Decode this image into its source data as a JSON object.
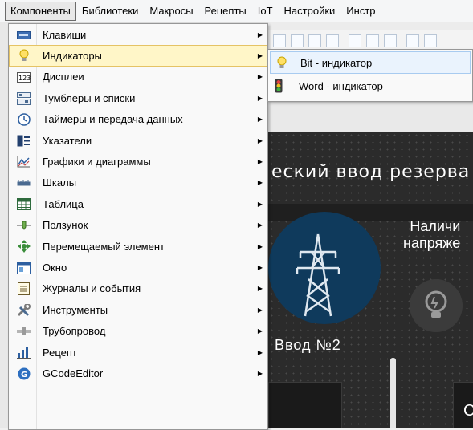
{
  "menubar": {
    "items": [
      "Компоненты",
      "Библиотеки",
      "Макросы",
      "Рецепты",
      "IoT",
      "Настройки",
      "Инстр"
    ]
  },
  "dropdown": {
    "items": [
      {
        "label": "Клавиши",
        "icon": "keyboard-icon"
      },
      {
        "label": "Индикаторы",
        "icon": "bulb-icon"
      },
      {
        "label": "Дисплеи",
        "icon": "display-123-icon"
      },
      {
        "label": "Тумблеры и списки",
        "icon": "toggle-list-icon"
      },
      {
        "label": "Таймеры и передача данных",
        "icon": "clock-icon"
      },
      {
        "label": "Указатели",
        "icon": "pointer-icon"
      },
      {
        "label": "Графики и диаграммы",
        "icon": "chart-icon"
      },
      {
        "label": "Шкалы",
        "icon": "scale-icon"
      },
      {
        "label": "Таблица",
        "icon": "table-icon"
      },
      {
        "label": "Ползунок",
        "icon": "slider-icon"
      },
      {
        "label": "Перемещаемый элемент",
        "icon": "move-icon"
      },
      {
        "label": "Окно",
        "icon": "window-icon"
      },
      {
        "label": "Журналы и события",
        "icon": "log-icon"
      },
      {
        "label": "Инструменты",
        "icon": "tools-icon"
      },
      {
        "label": "Трубопровод",
        "icon": "pipe-icon"
      },
      {
        "label": "Рецепт",
        "icon": "recipe-icon"
      },
      {
        "label": "GCodeEditor",
        "icon": "gcode-icon"
      }
    ],
    "highlighted_index": 1
  },
  "submenu": {
    "items": [
      {
        "label": "Bit - индикатор",
        "icon": "bulb-icon"
      },
      {
        "label": "Word - индикатор",
        "icon": "traffic-light-icon"
      }
    ]
  },
  "workspace": {
    "title": "еский ввод резерва",
    "label_right_1": "Наличи",
    "label_right_2": "напряже",
    "vvod": "Ввод №2",
    "box_right": "С"
  },
  "colors": {
    "highlight_fill": "#fff6c8",
    "highlight_border": "#e5c365",
    "submenu_highlight": "#eaf3fd",
    "hmi_bg": "#2b2b2b",
    "circle": "#0f3a5c"
  }
}
